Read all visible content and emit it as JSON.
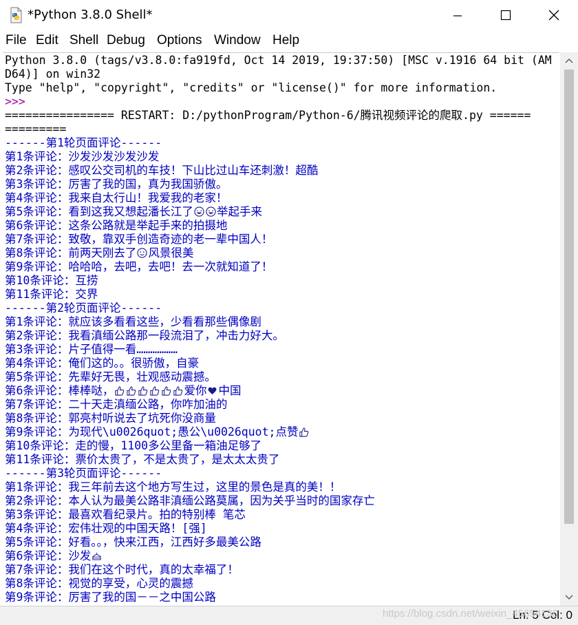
{
  "window": {
    "title": "*Python 3.8.0 Shell*",
    "controls": {
      "minimize": "minimize",
      "maximize": "maximize",
      "close": "close"
    }
  },
  "menu": [
    "File",
    "Edit",
    "Shell",
    "Debug",
    "Options",
    "Window",
    "Help"
  ],
  "shell": {
    "lines": [
      {
        "text": "Python 3.8.0 (tags/v3.8.0:fa919fd, Oct 14 2019, 19:37:50) [MSC v.1916 64 bit (AM",
        "style": "sys"
      },
      {
        "text": "D64)] on win32",
        "style": "sys"
      },
      {
        "text": "Type \"help\", \"copyright\", \"credits\" or \"license()\" for more information.",
        "style": "sys"
      },
      {
        "text": ">>> ",
        "style": "prompt"
      },
      {
        "text": "================ RESTART: D:/pythonProgram/Python-6/腾讯视频评论的爬取.py ======",
        "style": "restart"
      },
      {
        "text": "=========",
        "style": "restart"
      },
      {
        "text": "------第1轮页面评论------",
        "style": "out"
      },
      {
        "text": "第1条评论：沙发沙发沙发沙发",
        "style": "out"
      },
      {
        "text": "第2条评论：感叹公交司机的车技！下山比过山车还刺激！超酷",
        "style": "out"
      },
      {
        "text": "第3条评论：厉害了我的国，真为我国骄傲。",
        "style": "out"
      },
      {
        "text": "第4条评论：我来自太行山！我爱我的老家！",
        "style": "out"
      },
      {
        "text": "第5条评论：看到这我又想起潘长江了{e:laugh}{e:laugh}举起手来",
        "style": "out"
      },
      {
        "text": "第6条评论：这条公路就是举起手来的拍摄地",
        "style": "out"
      },
      {
        "text": "第7条评论：致敬，靠双手创造奇迹的老一辈中国人！",
        "style": "out"
      },
      {
        "text": "第8条评论：前两天刚去了{e:smile}风景很美",
        "style": "out"
      },
      {
        "text": "第9条评论：哈哈哈，去吧，去吧！去一次就知道了！",
        "style": "out"
      },
      {
        "text": "第10条评论：互捞",
        "style": "out"
      },
      {
        "text": "第11条评论：交界",
        "style": "out"
      },
      {
        "text": "------第2轮页面评论------",
        "style": "out"
      },
      {
        "text": "第1条评论：就应该多看看这些，少看看那些偶像剧",
        "style": "out"
      },
      {
        "text": "第2条评论：我看滇缅公路那一段流泪了，冲击力好大。",
        "style": "out"
      },
      {
        "text": "第3条评论：片子值得一看………………",
        "style": "out"
      },
      {
        "text": "第4条评论：俺们这的。。很骄傲，自豪",
        "style": "out"
      },
      {
        "text": "第5条评论：先辈好无畏，壮观感动震撼。",
        "style": "out"
      },
      {
        "text": "第6条评论：棒棒哒，{e:thumb}{e:thumb}{e:thumb}{e:thumb}{e:thumb}{e:thumb}爱你{e:heart}中国",
        "style": "out"
      },
      {
        "text": "第7条评论：二十天走滇缅公路，你咋加油的",
        "style": "out"
      },
      {
        "text": "第8条评论：郭亮村听说去了坑死你没商量",
        "style": "out"
      },
      {
        "text": "第9条评论：为现代\\u0026quot;愚公\\u0026quot;点赞{e:thumb}",
        "style": "out"
      },
      {
        "text": "第10条评论：走的慢，1100多公里备一箱油足够了",
        "style": "out"
      },
      {
        "text": "第11条评论：票价太贵了，不是太贵了，是太太太贵了",
        "style": "out"
      },
      {
        "text": "------第3轮页面评论------",
        "style": "out"
      },
      {
        "text": "第1条评论：我三年前去这个地方写生过，这里的景色是真的美！！",
        "style": "out"
      },
      {
        "text": "第2条评论：本人认为最美公路非滇缅公路莫属，因为关乎当时的国家存亡",
        "style": "out"
      },
      {
        "text": "第3条评论：最喜欢看纪录片。拍的特别棒 笔芯",
        "style": "out"
      },
      {
        "text": "第4条评论：宏伟壮观的中国天路！[强]",
        "style": "out"
      },
      {
        "text": "第5条评论：好看。。，快来江西，江西好多最美公路",
        "style": "out"
      },
      {
        "text": "第6条评论：沙发{e:cake}",
        "style": "out"
      },
      {
        "text": "第7条评论：我们在这个时代，真的太幸福了！",
        "style": "out"
      },
      {
        "text": "第8条评论：视觉的享受，心灵的震撼",
        "style": "out"
      },
      {
        "text": "第9条评论：厉害了我的国－－之中国公路",
        "style": "out"
      }
    ]
  },
  "status": {
    "text": "Ln: 5  Col: 0"
  },
  "watermark": "https://blog.csdn.net/weixin_45654130",
  "colors": {
    "output": "#0000c0",
    "prompt": "#a000a0",
    "text": "#000000"
  },
  "icons": [
    "python-idle-icon",
    "minimize-icon",
    "maximize-icon",
    "close-icon",
    "scroll-up-arrow-icon",
    "scroll-down-arrow-icon"
  ]
}
